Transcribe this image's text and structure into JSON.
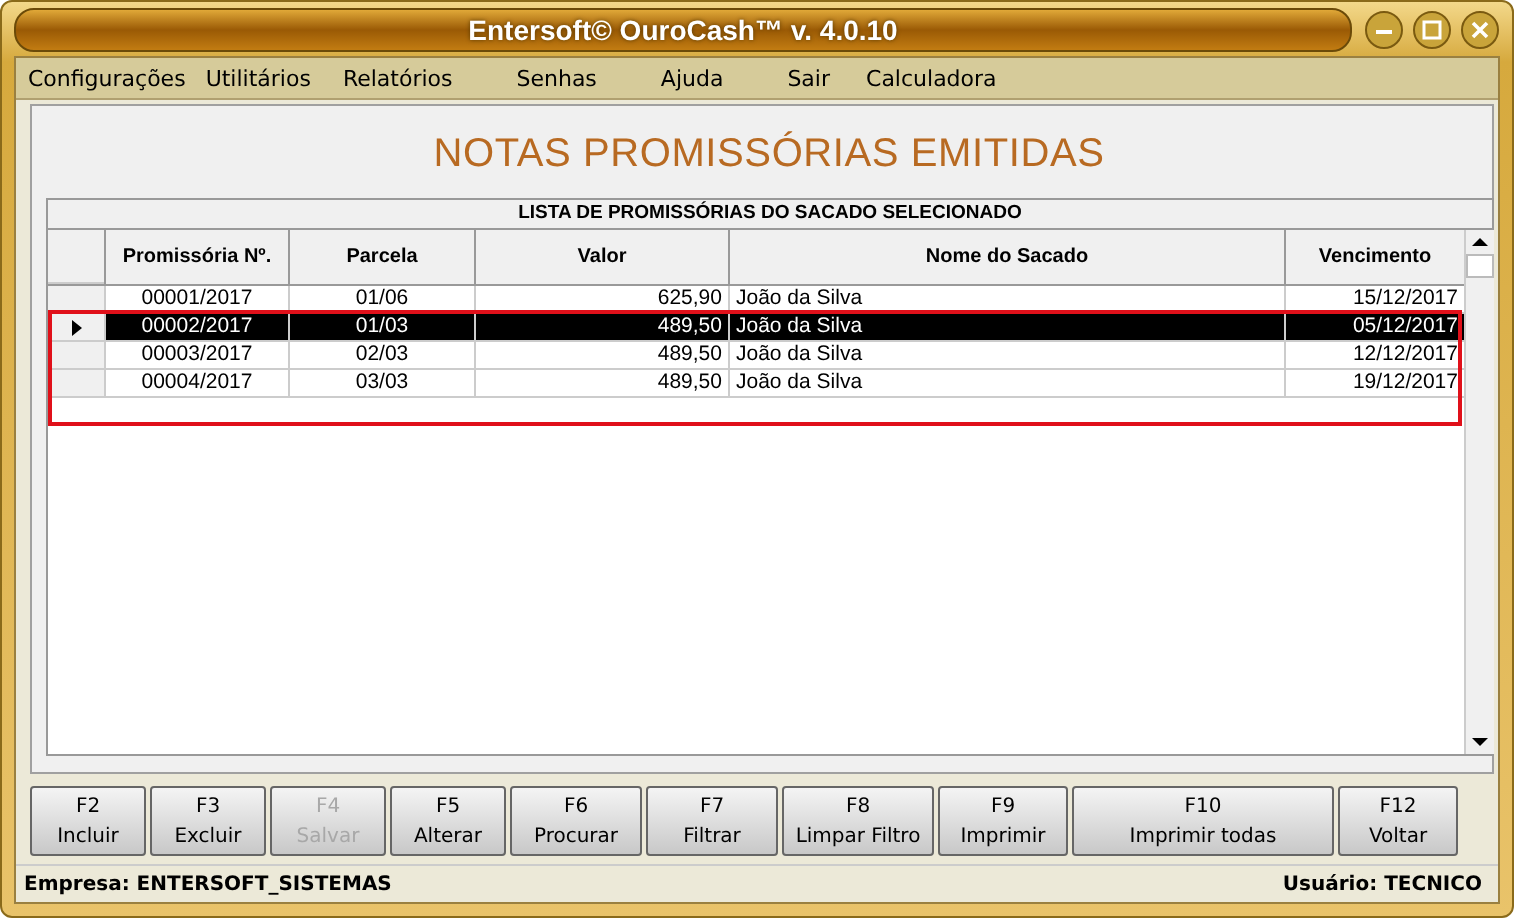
{
  "window": {
    "title": "Entersoft© OuroCash™ v. 4.0.10"
  },
  "menu": [
    "Configurações",
    "Utilitários",
    "Relatórios",
    "Senhas",
    "Ajuda",
    "Sair",
    "Calculadora"
  ],
  "heading": "NOTAS PROMISSÓRIAS EMITIDAS",
  "table": {
    "caption": "LISTA DE PROMISSÓRIAS DO SACADO SELECIONADO",
    "columns": [
      "Promissória Nº.",
      "Parcela",
      "Valor",
      "Nome do Sacado",
      "Vencimento"
    ],
    "rows": [
      {
        "cells": [
          "00001/2017",
          "01/06",
          "625,90",
          "João da Silva",
          "15/12/2017"
        ],
        "selected": false
      },
      {
        "cells": [
          "00002/2017",
          "01/03",
          "489,50",
          "João da Silva",
          "05/12/2017"
        ],
        "selected": true
      },
      {
        "cells": [
          "00003/2017",
          "02/03",
          "489,50",
          "João da Silva",
          "12/12/2017"
        ],
        "selected": false
      },
      {
        "cells": [
          "00004/2017",
          "03/03",
          "489,50",
          "João da Silva",
          "19/12/2017"
        ],
        "selected": false
      }
    ]
  },
  "buttons": [
    {
      "key": "F2",
      "label": "Incluir",
      "disabled": false
    },
    {
      "key": "F3",
      "label": "Excluir",
      "disabled": false
    },
    {
      "key": "F4",
      "label": "Salvar",
      "disabled": true
    },
    {
      "key": "F5",
      "label": "Alterar",
      "disabled": false
    },
    {
      "key": "F6",
      "label": "Procurar",
      "disabled": false
    },
    {
      "key": "F7",
      "label": "Filtrar",
      "disabled": false
    },
    {
      "key": "F8",
      "label": "Limpar Filtro",
      "disabled": false
    },
    {
      "key": "F9",
      "label": "Imprimir",
      "disabled": false
    },
    {
      "key": "F10",
      "label": "Imprimir todas",
      "disabled": false
    },
    {
      "key": "F12",
      "label": "Voltar",
      "disabled": false
    }
  ],
  "status_bar": {
    "left": "Empresa: ENTERSOFT_SISTEMAS",
    "right": "Usuário: TECNICO"
  }
}
